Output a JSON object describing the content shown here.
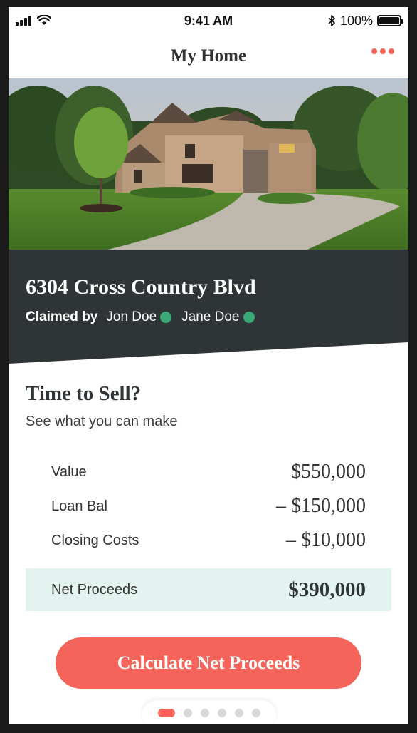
{
  "status_bar": {
    "time": "9:41 AM",
    "battery": "100%",
    "icons": [
      "signal-icon",
      "wifi-icon",
      "bluetooth-icon",
      "battery-icon"
    ]
  },
  "nav": {
    "title": "My Home",
    "more_icon": "more-icon"
  },
  "hero": {
    "image": "house-photo"
  },
  "property": {
    "address": "6304 Cross Country Blvd",
    "claimed_label": "Claimed by",
    "owners": [
      {
        "name": "Jon Doe",
        "verified": true
      },
      {
        "name": "Jane Doe",
        "verified": true
      }
    ]
  },
  "sell": {
    "title": "Time to Sell?",
    "subtitle": "See what you can make",
    "rows": [
      {
        "label": "Value",
        "value": "$550,000"
      },
      {
        "label": "Loan Bal",
        "value": "– $150,000"
      },
      {
        "label": "Closing Costs",
        "value": "– $10,000"
      }
    ],
    "net": {
      "label": "Net Proceeds",
      "value": "$390,000"
    },
    "cta_label": "Calculate Net Proceeds"
  },
  "pager": {
    "count": 6,
    "active_index": 0
  },
  "colors": {
    "accent": "#f4645a",
    "panel": "#2f3436",
    "net_bg": "#e3f3ef",
    "verified": "#3aa877"
  }
}
